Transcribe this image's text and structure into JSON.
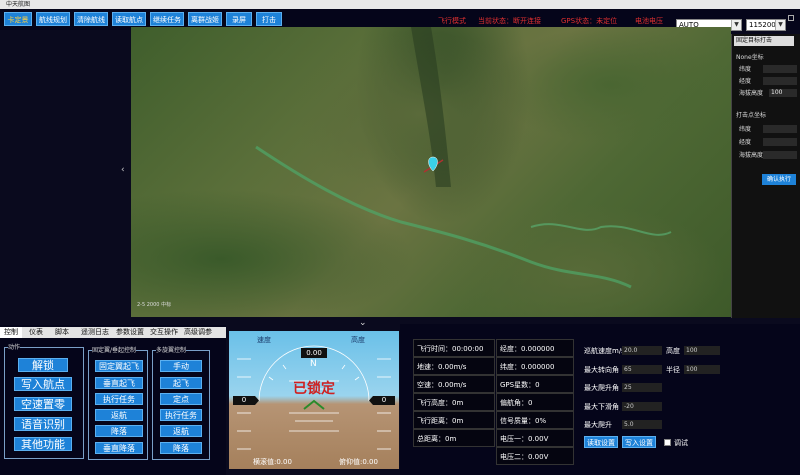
{
  "window": {
    "title": "中天航图"
  },
  "toolbar": {
    "buttons": [
      "卡定景",
      "航线规划",
      "清除航线",
      "读取航点",
      "继续任务",
      "离群战姬",
      "录屏",
      "打击"
    ],
    "status": [
      "飞行模式",
      "当前状态：断开连接",
      "GPS状态：未定位",
      "电池电压"
    ],
    "mode_select": "AUTO",
    "baud_select": "115200"
  },
  "right_panel": {
    "tab": "固定目标打击",
    "section1": "None坐标",
    "lat": "纬度",
    "lon": "经度",
    "alt_label": "海拔高度",
    "alt_value": "100",
    "section2": "打击点坐标",
    "lat2": "纬度",
    "lon2": "经度",
    "alt2": "海拔高度",
    "exec": "确认执行"
  },
  "map": {
    "scale_label": "2-5 2000 中标"
  },
  "bottom_tabs": [
    "控制",
    "仪表",
    "脚本",
    "遥测日志",
    "参数设置",
    "交互操作",
    "高级调参"
  ],
  "control": {
    "group_action": "动作",
    "action_buttons": [
      "解锁",
      "写入航点",
      "空速置零",
      "语音识别",
      "其他功能"
    ],
    "group_fixed": "固定翼/垂起控制",
    "fixed_buttons": [
      "固定翼起飞",
      "垂直起飞",
      "执行任务",
      "返航",
      "降落",
      "垂直降落"
    ],
    "group_multi": "多旋翼控制",
    "multi_buttons": [
      "手动",
      "起飞",
      "定点",
      "执行任务",
      "返航",
      "降落"
    ]
  },
  "attitude": {
    "speed_label": "速度",
    "height_label": "高度",
    "heading": "0.00",
    "compass_n": "N",
    "lock_text": "已锁定",
    "left_value": "0",
    "right_value": "0",
    "roll_label": "横滚值:0.00",
    "pitch_label": "俯仰值:0.00"
  },
  "telemetry": {
    "col1": [
      "飞行时间：00:00:00",
      "地速：0.00m/s",
      "空速：0.00m/s",
      "飞行高度：0m",
      "飞行距离：0m",
      "总距离：0m"
    ],
    "col2": [
      "经度：0.000000",
      "纬度：0.000000",
      "GPS星数：0",
      "偏航角：0",
      "信号质量：0%",
      "电压一：0.00V",
      "电压二：0.00V"
    ]
  },
  "settings": {
    "rows": [
      {
        "label": "巡航速度m/s",
        "value": "20.0"
      },
      {
        "label": "最大转向角",
        "value": "65"
      },
      {
        "label": "最大爬升角",
        "value": "25"
      },
      {
        "label": "最大下滑角",
        "value": "-20"
      },
      {
        "label": "最大爬升",
        "value": "5.0"
      }
    ],
    "height_label": "高度",
    "height_value": "100",
    "radius_label": "半径",
    "radius_value": "100",
    "read_btn": "读取设置",
    "write_btn": "写入设置",
    "debug_label": "调试"
  },
  "colors": {
    "accent": "#1e82d8",
    "status_red": "#e03030",
    "bg": "#05051a"
  }
}
